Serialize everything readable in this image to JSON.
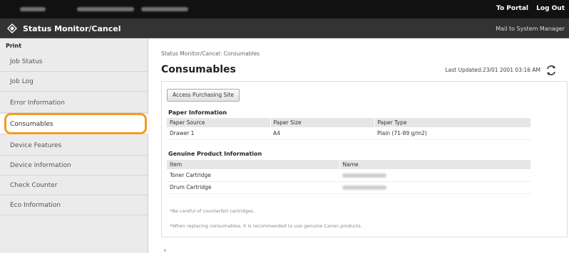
{
  "topbar": {
    "portal_link": "To Portal",
    "logout_link": "Log Out"
  },
  "header": {
    "title": "Status Monitor/Cancel",
    "mail_link": "Mail to System Manager"
  },
  "sidebar": {
    "section": "Print",
    "items": [
      {
        "label": "Job Status"
      },
      {
        "label": "Job Log"
      },
      {
        "label": "Error Information"
      },
      {
        "label": "Consumables"
      },
      {
        "label": "Device Features"
      },
      {
        "label": "Device Information"
      },
      {
        "label": "Check Counter"
      },
      {
        "label": "Eco Information"
      }
    ]
  },
  "main": {
    "breadcrumb": "Status Monitor/Cancel: Consumables",
    "title": "Consumables",
    "last_updated": "Last Updated:23/01 2001 03:16 AM",
    "purchase_button": "Access Purchasing Site",
    "paper": {
      "title": "Paper Information",
      "headers": [
        "Paper Source",
        "Paper Size",
        "Paper Type"
      ],
      "rows": [
        [
          "Drawer 1",
          "A4",
          "Plain (71-89 g/m2)"
        ]
      ]
    },
    "genuine": {
      "title": "Genuine Product Information",
      "headers": [
        "Item",
        "Name"
      ],
      "rows": [
        [
          "Toner Cartridge"
        ],
        [
          "Drum Cartridge"
        ]
      ]
    },
    "note1": "*Be careful of counterfeit cartridges.",
    "note2": "*When replacing consumables, it is recommended to use genuine Canon products."
  },
  "colors": {
    "highlight": "#f39c1e",
    "topbar": "#111111",
    "titlebar": "#333333"
  },
  "icons": [
    "logo-icon",
    "refresh-icon",
    "scroll-top-icon"
  ]
}
